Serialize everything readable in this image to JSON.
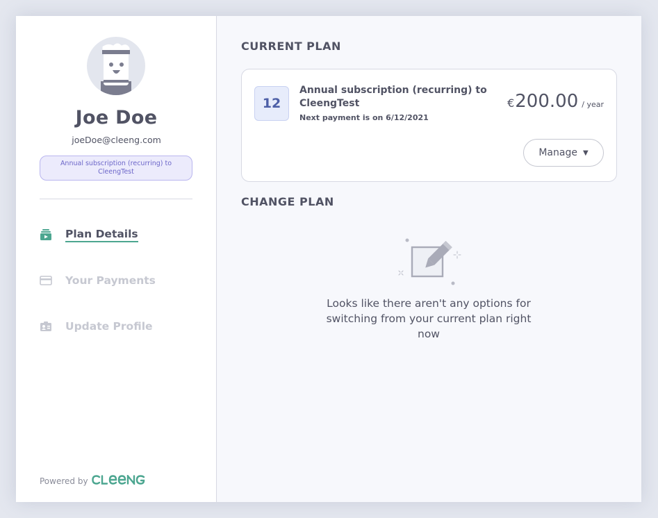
{
  "profile": {
    "name": "Joe Doe",
    "email": "joeDoe@cleeng.com",
    "subscription_badge": "Annual subscription (recurring) to CleengTest"
  },
  "nav": {
    "items": [
      {
        "label": "Plan Details",
        "icon": "plan-details-icon",
        "active": true
      },
      {
        "label": "Your Payments",
        "icon": "credit-card-icon",
        "active": false
      },
      {
        "label": "Update Profile",
        "icon": "id-card-icon",
        "active": false
      }
    ]
  },
  "footer": {
    "powered_by": "Powered by",
    "brand": "CLEENG"
  },
  "current_plan": {
    "section_title": "CURRENT PLAN",
    "period_number": "12",
    "title": "Annual subscription (recurring) to CleengTest",
    "next_payment": "Next payment is on 6/12/2021",
    "currency": "€",
    "price": "200.00",
    "period": "/ year",
    "manage_label": "Manage",
    "manage_caret": "▼"
  },
  "change_plan": {
    "section_title": "CHANGE PLAN",
    "empty_message": "Looks like there aren't any options for switching from your current plan right now",
    "illustration_icon": "edit-pencil-icon"
  },
  "colors": {
    "accent_green": "#4ca690",
    "badge_purple": "#6d67c9",
    "text_dark": "#515364",
    "text_muted": "#c6c8d1"
  }
}
